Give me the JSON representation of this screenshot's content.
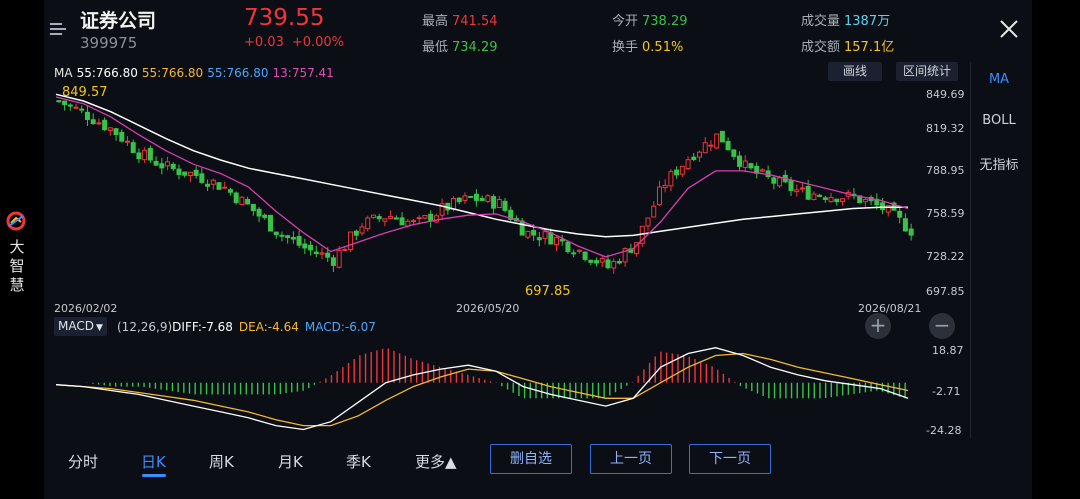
{
  "rail": {
    "text": "大智慧"
  },
  "header": {
    "name": "证券公司",
    "code": "399975",
    "price": "739.55",
    "change": "+0.03",
    "change_pct": "+0.00%",
    "high_label": "最高",
    "high": "741.54",
    "low_label": "最低",
    "low": "734.29",
    "open_label": "今开",
    "open": "738.29",
    "turnover_label": "换手",
    "turnover": "0.51%",
    "volume_label": "成交量",
    "volume": "1387万",
    "amount_label": "成交额",
    "amount": "157.1亿"
  },
  "ma": {
    "label": "MA",
    "ma5": "55:766.80",
    "ma10": "55:766.80",
    "ma20": "55:766.80",
    "ma13": "13:757.41"
  },
  "toolbar": {
    "draw": "画线",
    "range_stats": "区间统计"
  },
  "side_tabs": [
    "MA",
    "BOLL",
    "无指标"
  ],
  "price_axis": [
    "849.69",
    "819.32",
    "788.95",
    "758.59",
    "728.22",
    "697.85"
  ],
  "dates": [
    "2026/02/02",
    "2026/05/20",
    "2026/08/21"
  ],
  "annotations": {
    "high": "849.57",
    "low": "697.85"
  },
  "macd": {
    "selector": "MACD",
    "params": "(12,26,9)",
    "diff": "DIFF:-7.68",
    "dea": "DEA:-4.64",
    "macd": "MACD:-6.07",
    "axis": [
      "18.87",
      "-2.71",
      "-24.28"
    ]
  },
  "zoom": {
    "in": "+",
    "out": "−"
  },
  "bottom_tabs": [
    "分时",
    "日K",
    "周K",
    "月K",
    "季K",
    "更多▲"
  ],
  "actions": [
    "删自选",
    "上一页",
    "下一页"
  ],
  "colors": {
    "up": "#f0353b",
    "down": "#39c24a",
    "accent": "#3b8cff",
    "ma_white": "#ffffff",
    "ma_pink": "#d63fae",
    "dea_yellow": "#f5b82e"
  },
  "chart_data": {
    "type": "candlestick",
    "title": "",
    "x_range": [
      "2026/02/02",
      "2026/08/21"
    ],
    "y_range": [
      697.85,
      849.69
    ],
    "ma_long_line": [
      845,
      840,
      832,
      822,
      812,
      803,
      796,
      790,
      786,
      782,
      778,
      774,
      770,
      766,
      762,
      757,
      752,
      748,
      744,
      741,
      739,
      740,
      743,
      746,
      749,
      752,
      754,
      756,
      758,
      760,
      761,
      761
    ],
    "ma_short_line": [
      843,
      838,
      828,
      815,
      803,
      793,
      786,
      776,
      758,
      742,
      728,
      735,
      742,
      748,
      752,
      755,
      756,
      750,
      742,
      732,
      724,
      730,
      750,
      775,
      788,
      788,
      785,
      780,
      775,
      770,
      766,
      760
    ],
    "close_line": [
      840,
      830,
      818,
      800,
      790,
      785,
      776,
      760,
      742,
      730,
      722,
      748,
      755,
      748,
      760,
      768,
      764,
      742,
      738,
      728,
      716,
      735,
      778,
      800,
      815,
      790,
      780,
      772,
      770,
      768,
      760,
      744
    ],
    "macd_diff": [
      -1,
      -2,
      -4,
      -6,
      -9,
      -12,
      -15,
      -18,
      -22,
      -24,
      -20,
      -10,
      0,
      4,
      7,
      9,
      6,
      -2,
      -6,
      -9,
      -12,
      -8,
      8,
      15,
      18,
      14,
      8,
      4,
      1,
      -1,
      -3,
      -8
    ],
    "macd_dea": [
      -1,
      -2,
      -3,
      -5,
      -7,
      -9,
      -12,
      -15,
      -19,
      -22,
      -22,
      -17,
      -9,
      -2,
      3,
      7,
      6,
      2,
      -2,
      -5,
      -8,
      -8,
      0,
      8,
      14,
      15,
      12,
      8,
      5,
      2,
      -1,
      -4
    ]
  }
}
